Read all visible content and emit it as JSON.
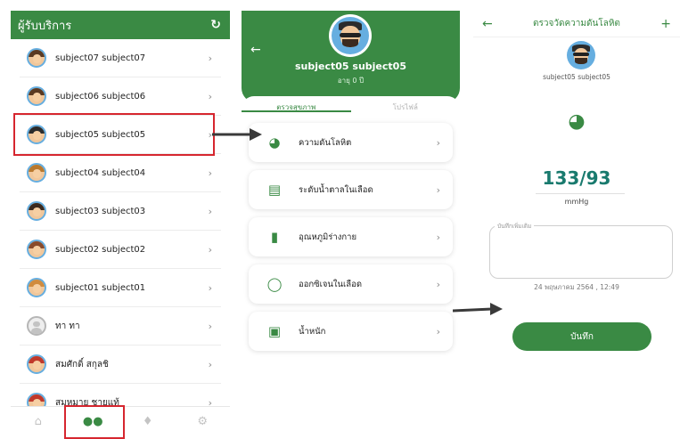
{
  "list_panel": {
    "title": "ผู้รับบริการ",
    "items": [
      {
        "name": "subject07 subject07"
      },
      {
        "name": "subject06 subject06"
      },
      {
        "name": "subject05 subject05"
      },
      {
        "name": "subject04 subject04"
      },
      {
        "name": "subject03 subject03"
      },
      {
        "name": "subject02 subject02"
      },
      {
        "name": "subject01 subject01"
      },
      {
        "name": "ทา ทา"
      },
      {
        "name": "สมศักดิ์ สกุลชิ"
      },
      {
        "name": "สมหมาย ชายแท้"
      }
    ],
    "tabs": [
      "home-icon",
      "people-icon",
      "bell-icon",
      "gear-icon"
    ]
  },
  "detail_panel": {
    "name": "subject05 subject05",
    "age": "อายุ 0 ปี",
    "tabs": [
      "ตรวจสุขภาพ",
      "โปรไฟล์"
    ],
    "menu": [
      {
        "label": "ความดันโลหิต",
        "icon": "blood-pressure-icon"
      },
      {
        "label": "ระดับน้ำตาลในเลือด",
        "icon": "glucose-meter-icon"
      },
      {
        "label": "อุณหภูมิร่างกาย",
        "icon": "thermometer-icon"
      },
      {
        "label": "ออกซิเจนในเลือด",
        "icon": "oxygen-icon"
      },
      {
        "label": "น้ำหนัก",
        "icon": "scale-icon"
      }
    ]
  },
  "bp_panel": {
    "title": "ตรวจวัดความดันโลหิต",
    "name": "subject05 subject05",
    "value": "133/93",
    "unit": "mmHg",
    "note_label": "บันทึกเพิ่มเติม",
    "date": "24 พฤษภาคม 2564 , 12:49",
    "save_label": "บันทึก"
  },
  "colors": {
    "primary": "#3a8a44",
    "value": "#197a6e",
    "highlight": "#d6262f"
  }
}
